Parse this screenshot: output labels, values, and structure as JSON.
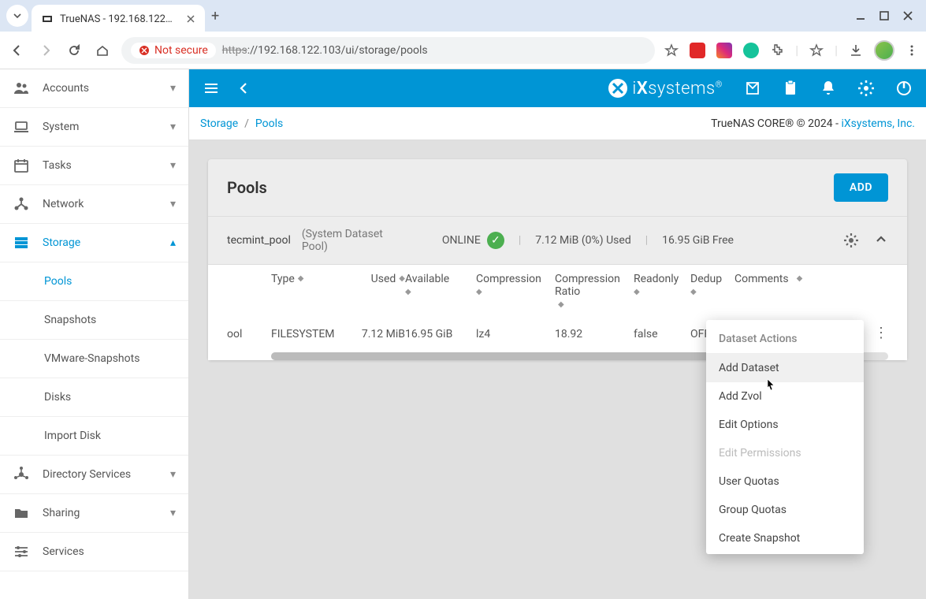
{
  "browser": {
    "tab_title": "TrueNAS - 192.168.122…",
    "not_secure": "Not secure",
    "url_scheme": "https",
    "url_rest": "://192.168.122.103/ui/storage/pools"
  },
  "topbar": {
    "brand": "systems"
  },
  "breadcrumb": {
    "root": "Storage",
    "leaf": "Pools",
    "copyright": "TrueNAS CORE® © 2024 - ",
    "vendor": "iXsystems, Inc."
  },
  "sidebar": {
    "items": [
      {
        "icon": "people",
        "label": "Accounts",
        "active": false,
        "expandable": true
      },
      {
        "icon": "laptop",
        "label": "System",
        "active": false,
        "expandable": true
      },
      {
        "icon": "calendar",
        "label": "Tasks",
        "active": false,
        "expandable": true
      },
      {
        "icon": "network",
        "label": "Network",
        "active": false,
        "expandable": true
      },
      {
        "icon": "storage",
        "label": "Storage",
        "active": true,
        "expandable": true,
        "expanded": true,
        "children": [
          {
            "label": "Pools",
            "active": true
          },
          {
            "label": "Snapshots",
            "active": false
          },
          {
            "label": "VMware-Snapshots",
            "active": false
          },
          {
            "label": "Disks",
            "active": false
          },
          {
            "label": "Import Disk",
            "active": false
          }
        ]
      },
      {
        "icon": "hub",
        "label": "Directory Services",
        "active": false,
        "expandable": true
      },
      {
        "icon": "folder-shared",
        "label": "Sharing",
        "active": false,
        "expandable": true
      },
      {
        "icon": "tune",
        "label": "Services",
        "active": false,
        "expandable": false
      }
    ]
  },
  "page": {
    "title": "Pools",
    "add_button": "ADD"
  },
  "pool": {
    "name": "tecmint_pool",
    "label": "(System Dataset Pool)",
    "status": "ONLINE",
    "used": "7.12 MiB (0%) Used",
    "free": "16.95 GiB Free"
  },
  "table": {
    "columns": [
      "Type",
      "Used",
      "Available",
      "Compression",
      "Compression Ratio",
      "Readonly",
      "Dedup",
      "Comments"
    ],
    "row": {
      "name_frag": "ool",
      "type": "FILESYSTEM",
      "used": "7.12 MiB",
      "available": "16.95 GiB",
      "compression": "lz4",
      "ratio": "18.92",
      "readonly": "false",
      "dedup": "OFF",
      "comments": ""
    }
  },
  "menu": {
    "header": "Dataset Actions",
    "items": [
      {
        "label": "Add Dataset",
        "hover": true,
        "disabled": false
      },
      {
        "label": "Add Zvol",
        "hover": false,
        "disabled": false
      },
      {
        "label": "Edit Options",
        "hover": false,
        "disabled": false
      },
      {
        "label": "Edit Permissions",
        "hover": false,
        "disabled": true
      },
      {
        "label": "User Quotas",
        "hover": false,
        "disabled": false
      },
      {
        "label": "Group Quotas",
        "hover": false,
        "disabled": false
      },
      {
        "label": "Create Snapshot",
        "hover": false,
        "disabled": false
      }
    ]
  }
}
